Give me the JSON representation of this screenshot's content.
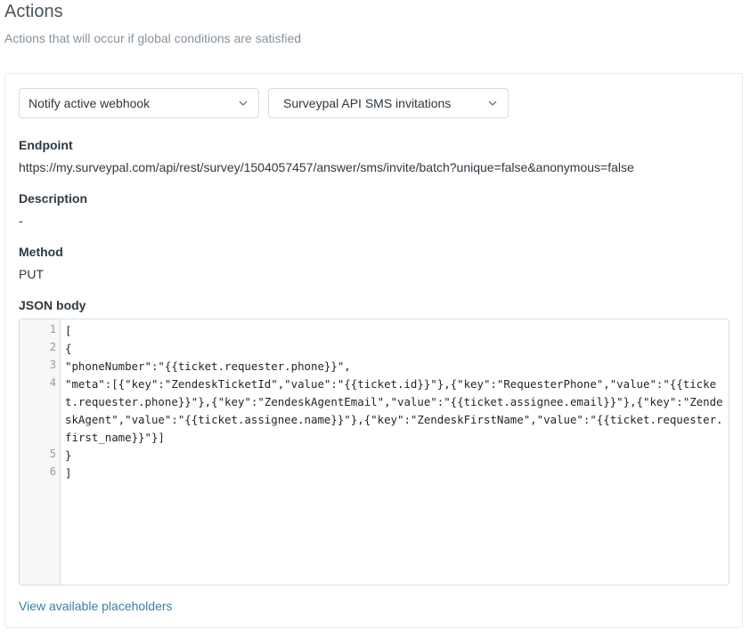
{
  "section": {
    "title": "Actions",
    "subtitle": "Actions that will occur if global conditions are satisfied"
  },
  "action": {
    "type_select": "Notify active webhook",
    "webhook_select": "Surveypal API SMS invitations",
    "endpoint_label": "Endpoint",
    "endpoint_value": "https://my.surveypal.com/api/rest/survey/1504057457/answer/sms/invite/batch?unique=false&anonymous=false",
    "description_label": "Description",
    "description_value": "-",
    "method_label": "Method",
    "method_value": "PUT",
    "json_label": "JSON body",
    "json_lines": [
      {
        "num": "1",
        "text": "["
      },
      {
        "num": "2",
        "text": "{"
      },
      {
        "num": "3",
        "text": "\"phoneNumber\":\"{{ticket.requester.phone}}\","
      },
      {
        "num": "4",
        "text": "\"meta\":[{\"key\":\"ZendeskTicketId\",\"value\":\"{{ticket.id}}\"},{\"key\":\"RequesterPhone\",\"value\":\"{{ticket.requester.phone}}\"},{\"key\":\"ZendeskAgentEmail\",\"value\":\"{{ticket.assignee.email}}\"},{\"key\":\"ZendeskAgent\",\"value\":\"{{ticket.assignee.name}}\"},{\"key\":\"ZendeskFirstName\",\"value\":\"{{ticket.requester.first_name}}\"}]"
      },
      {
        "num": "5",
        "text": "}"
      },
      {
        "num": "6",
        "text": "]"
      }
    ],
    "placeholders_link": "View available placeholders"
  }
}
